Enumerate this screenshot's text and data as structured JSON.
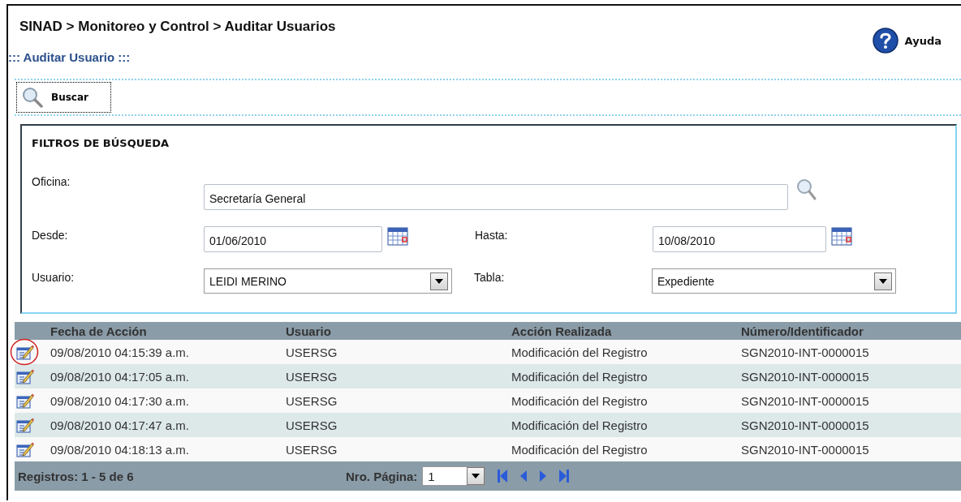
{
  "breadcrumb": "SINAD > Monitoreo y Control > Auditar Usuarios",
  "subtitle": "::: Auditar Usuario :::",
  "help": {
    "label": "Ayuda"
  },
  "toolbar": {
    "search_button": "Buscar"
  },
  "filters": {
    "title": "FILTROS DE BÚSQUEDA",
    "oficina": {
      "label": "Oficina:",
      "value": "Secretaría General"
    },
    "desde": {
      "label": "Desde:",
      "value": "01/06/2010"
    },
    "hasta": {
      "label": "Hasta:",
      "value": "10/08/2010"
    },
    "usuario": {
      "label": "Usuario:",
      "value": "LEIDI MERINO"
    },
    "tabla": {
      "label": "Tabla:",
      "value": "Expediente"
    }
  },
  "table": {
    "columns": [
      "Fecha de Acción",
      "Usuario",
      "Acción Realizada",
      "Número/Identificador"
    ],
    "rows": [
      {
        "cells": [
          "09/08/2010 04:15:39 a.m.",
          "USERSG",
          "Modificación del Registro",
          "SGN2010-INT-0000015"
        ],
        "circled": true
      },
      {
        "cells": [
          "09/08/2010 04:17:05 a.m.",
          "USERSG",
          "Modificación del Registro",
          "SGN2010-INT-0000015"
        ],
        "circled": false
      },
      {
        "cells": [
          "09/08/2010 04:17:30 a.m.",
          "USERSG",
          "Modificación del Registro",
          "SGN2010-INT-0000015"
        ],
        "circled": false
      },
      {
        "cells": [
          "09/08/2010 04:17:47 a.m.",
          "USERSG",
          "Modificación del Registro",
          "SGN2010-INT-0000015"
        ],
        "circled": false
      },
      {
        "cells": [
          "09/08/2010 04:18:13 a.m.",
          "USERSG",
          "Modificación del Registro",
          "SGN2010-INT-0000015"
        ],
        "circled": false
      }
    ]
  },
  "pager": {
    "records": "Registros: 1 - 5 de 6",
    "page_label": "Nro. Página:",
    "page": "1"
  }
}
